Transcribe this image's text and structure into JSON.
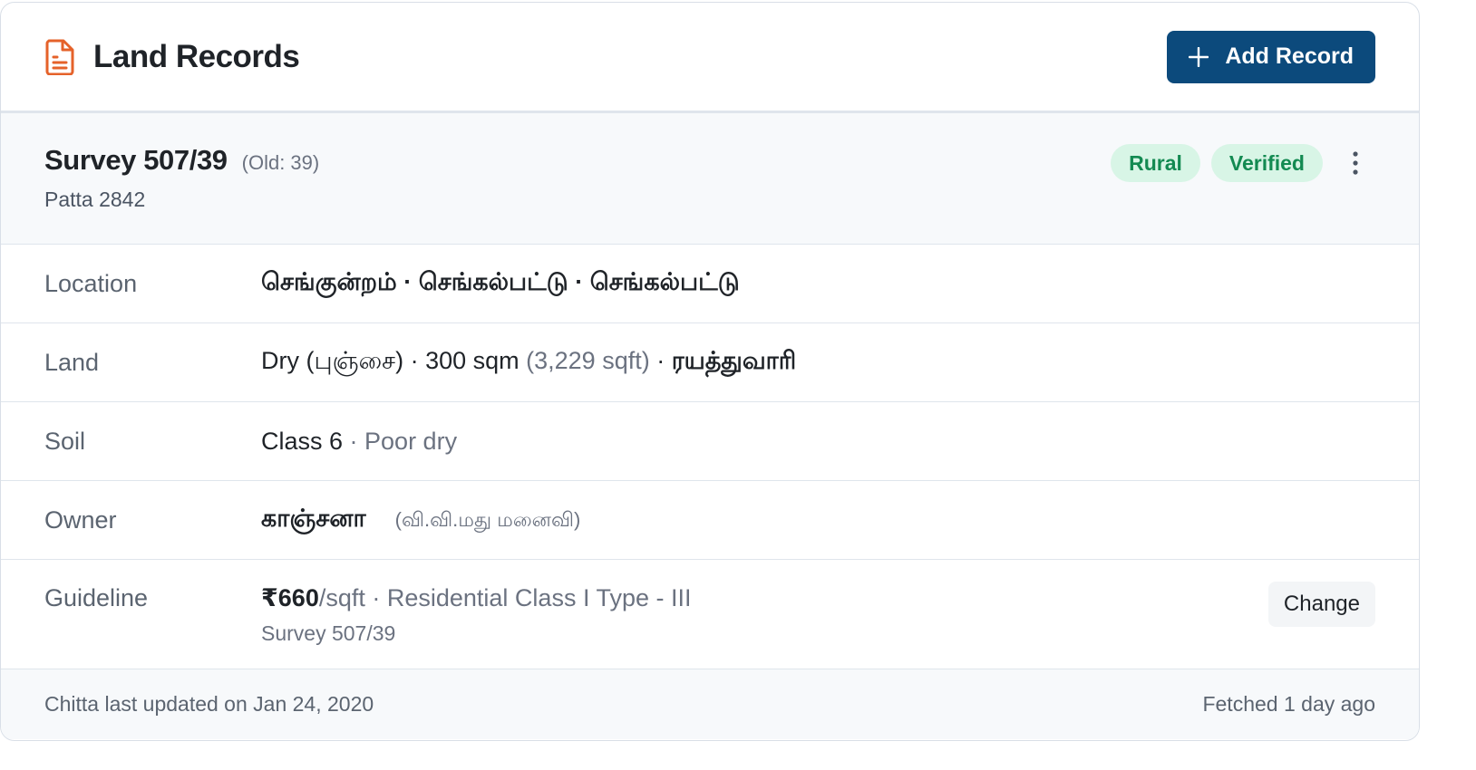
{
  "header": {
    "title": "Land Records",
    "title_icon": "document-icon",
    "add_button_label": "Add Record",
    "add_button_icon": "plus-icon"
  },
  "colors": {
    "accent": "#0c4a7c",
    "icon_orange": "#e5622a",
    "badge_bg": "#d8f5e6",
    "badge_text": "#138a52"
  },
  "record": {
    "survey_title": "Survey 507/39",
    "old_number": "(Old: 39)",
    "patta": "Patta 2842",
    "badges": [
      "Rural",
      "Verified"
    ],
    "menu_icon": "more-vertical-icon",
    "fields": {
      "location": {
        "label": "Location",
        "value": "செங்குன்றம் · செங்கல்பட்டு · செங்கல்பட்டு"
      },
      "land": {
        "label": "Land",
        "type": "Dry (புஞ்சை)",
        "sep1": " · ",
        "area": "300 sqm",
        "area_alt": " (3,229 sqft)",
        "sep2": " · ",
        "tenure": "ரயத்துவாரி"
      },
      "soil": {
        "label": "Soil",
        "class": "Class 6",
        "desc": " · Poor dry"
      },
      "owner": {
        "label": "Owner",
        "name": "காஞ்சனா",
        "relation": "(வி.வி.மது மனைவி)"
      },
      "guideline": {
        "label": "Guideline",
        "price": "₹660",
        "unit_desc": "/sqft · Residential Class I Type - III",
        "survey_ref": "Survey 507/39",
        "change_label": "Change"
      }
    }
  },
  "footer": {
    "updated": "Chitta last updated on Jan 24, 2020",
    "fetched": "Fetched 1 day ago"
  }
}
